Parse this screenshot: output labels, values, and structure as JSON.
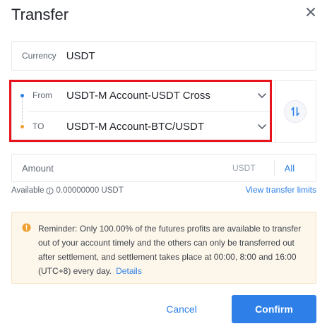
{
  "dialog": {
    "title": "Transfer",
    "close_icon": "close-icon"
  },
  "currency": {
    "label": "Currency",
    "value": "USDT"
  },
  "from": {
    "label": "From",
    "value": "USDT-M Account-USDT Cross"
  },
  "to": {
    "label": "TO",
    "value": "USDT-M Account-BTC/USDT"
  },
  "amount": {
    "placeholder": "Amount",
    "unit": "USDT",
    "all_label": "All"
  },
  "available": {
    "label": "Available",
    "value": "0.00000000 USDT",
    "view_limits": "View transfer limits"
  },
  "reminder": {
    "text": "Reminder: Only 100.00% of the futures profits are available to transfer out of your account timely and the others can only be transferred out after settlement, and settlement takes place at 00:00, 8:00 and 16:00 (UTC+8) every day.",
    "details_label": "Details"
  },
  "actions": {
    "cancel_label": "Cancel",
    "confirm_label": "Confirm"
  },
  "colors": {
    "accent": "#2e80e8",
    "highlight": "#e8141c",
    "warning": "#f0a030",
    "reminder_bg": "#fdf6ea"
  }
}
